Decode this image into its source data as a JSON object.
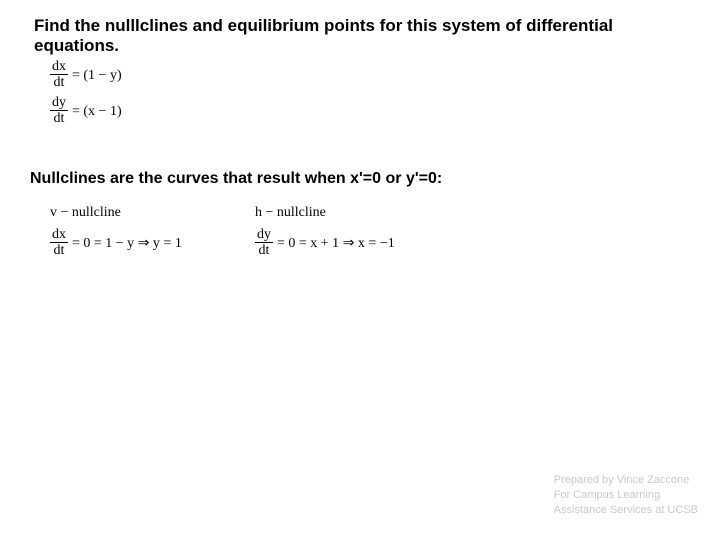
{
  "title": "Find the nulllclines and equilibrium points for this system of differential equations.",
  "system": {
    "eq1_lhs_num": "dx",
    "eq1_lhs_den": "dt",
    "eq1_rhs": "= (1 − y)",
    "eq2_lhs_num": "dy",
    "eq2_lhs_den": "dt",
    "eq2_rhs": "= (x − 1)"
  },
  "subhead": "Nullclines are the curves that result when x'=0 or y'=0:",
  "vblock": {
    "label": "v − nullcline",
    "lhs_num": "dx",
    "lhs_den": "dt",
    "rhs": "= 0 = 1 − y ⇒ y = 1"
  },
  "hblock": {
    "label": "h − nullcline",
    "lhs_num": "dy",
    "lhs_den": "dt",
    "rhs": "= 0 = x + 1 ⇒ x = −1"
  },
  "footer": {
    "line1": "Prepared by Vince Zaccone",
    "line2": "For Campus Learning",
    "line3": "Assistance Services at UCSB"
  }
}
